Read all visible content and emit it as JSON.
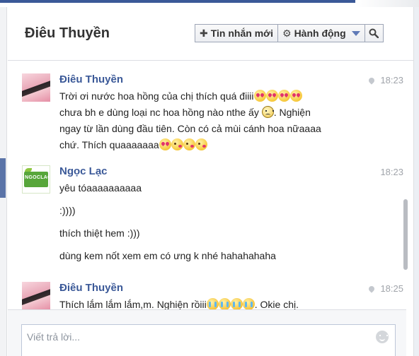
{
  "header": {
    "title": "Điêu Thuyền",
    "new_message_label": "Tin nhắn mới",
    "actions_label": "Hành động"
  },
  "messages": [
    {
      "sender": "Điêu Thuyền",
      "time": "18:23",
      "lines": [
        {
          "text": "Trời ơi nước hoa hồng của chị thích quá điiii",
          "emoji": [
            "heart-eyes",
            "heart-eyes",
            "heart-eyes",
            "heart-eyes"
          ]
        },
        {
          "text": "chưa bh e dùng loại nc hoa hồng nào nthe ấy",
          "text2": ". Nghiện",
          "emoji": [
            "frown"
          ]
        },
        {
          "text": "ngay từ lần dùng đầu tiên. Còn có cả mùi cánh hoa nữaaaa"
        },
        {
          "text": "chứ. Thích quaaaaaaa",
          "emoji": [
            "heart-eyes",
            "kiss",
            "kiss",
            "kiss"
          ]
        }
      ]
    },
    {
      "sender": "Ngọc Lạc",
      "avatar_text": "NGOCLAC",
      "time": "18:23",
      "lines": [
        {
          "text": "yêu tóaaaaaaaaaa"
        },
        {
          "text": ":))))"
        },
        {
          "text": "thích thiệt hem :)))"
        },
        {
          "text": "dùng kem nốt xem em có ưng k nhé hahahahaha"
        }
      ]
    },
    {
      "sender": "Điêu Thuyền",
      "time": "18:25",
      "lines": [
        {
          "text": "Thích lắm lắm lắm,m. Nghiện rồiii",
          "text2": ". Okie chị.",
          "emoji": [
            "crying",
            "crying",
            "crying",
            "crying"
          ]
        }
      ]
    }
  ],
  "composer": {
    "placeholder": "Viết trả lời..."
  },
  "icons": {
    "new_message": "plus-icon",
    "actions": "gear-icon",
    "search": "search-icon",
    "time": "location-pin-icon",
    "composer": "smiley-icon"
  },
  "colors": {
    "brand": "#3b5998",
    "sender_name": "#3b5998",
    "timestamp": "#a0a4aa"
  }
}
